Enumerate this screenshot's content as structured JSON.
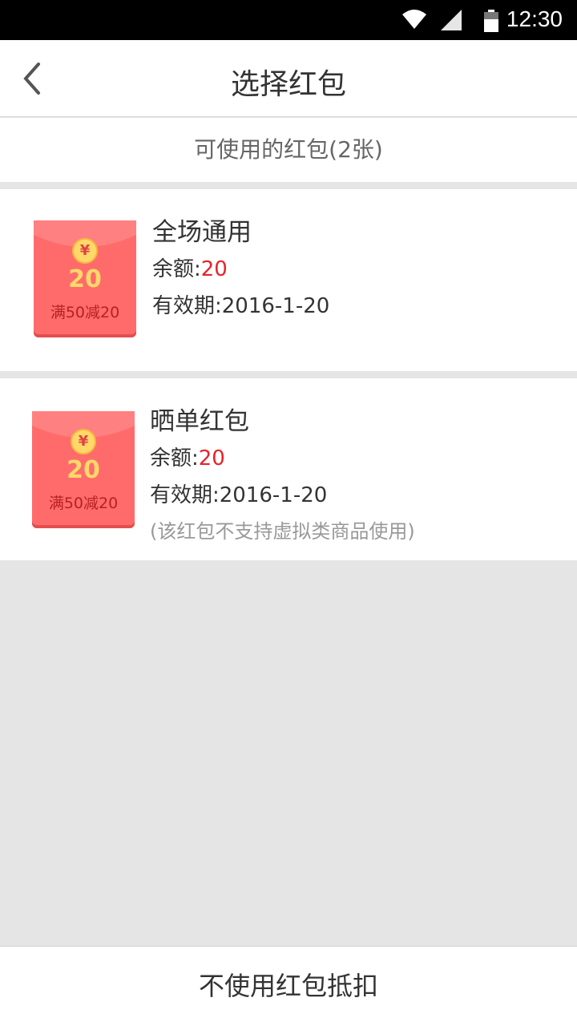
{
  "status_bar": {
    "time": "12:30",
    "icons": [
      "wifi-icon",
      "signal-icon",
      "battery-icon"
    ]
  },
  "header": {
    "title": "选择红包",
    "back_icon": "chevron-left-icon"
  },
  "subheader": {
    "label": "可使用的红包(2张)"
  },
  "coupons": [
    {
      "badge_symbol": "¥",
      "badge_amount": "20",
      "badge_condition": "满50减20",
      "name": "全场通用",
      "balance_label": "余额:",
      "balance_value": "20",
      "validity": "有效期:2016-1-20"
    },
    {
      "badge_symbol": "¥",
      "badge_amount": "20",
      "badge_condition": "满50减20",
      "name": "晒单红包",
      "balance_label": "余额:",
      "balance_value": "20",
      "validity": "有效期:2016-1-20",
      "note": "(该红包不支持虚拟类商品使用)"
    }
  ],
  "footer": {
    "button_label": "不使用红包抵扣"
  },
  "colors": {
    "accent_red": "#e8222b",
    "envelope_red": "#ff6b6b",
    "coin_gold": "#ffd86a"
  }
}
